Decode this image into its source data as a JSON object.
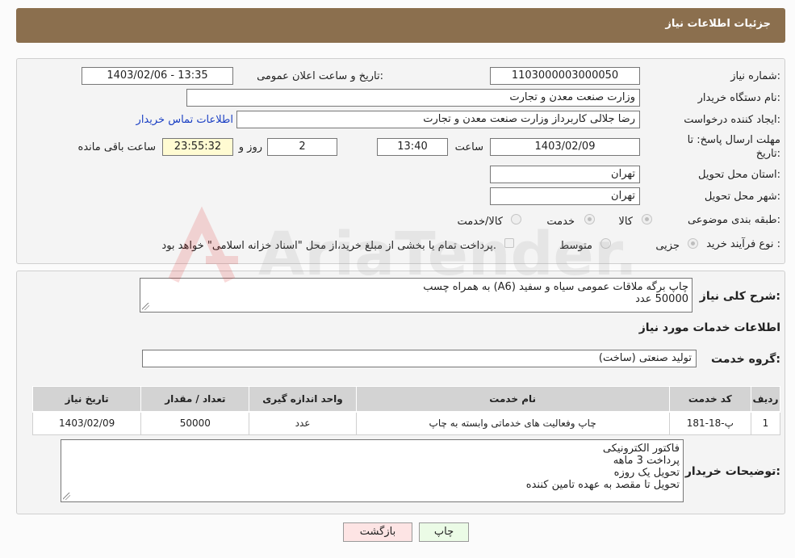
{
  "header": {
    "title": "جزئیات اطلاعات نیاز"
  },
  "form": {
    "need_number_label": "شماره نیاز:",
    "need_number": "1103000003000050",
    "announce_label": "تاریخ و ساعت اعلان عمومی:",
    "announce_value": "1403/02/06 - 13:35",
    "buyer_org_label": "نام دستگاه خریدار:",
    "buyer_org": "وزارت صنعت معدن و تجارت",
    "creator_label": "ایجاد کننده درخواست:",
    "creator": "رضا جلالی کاربرداز وزارت صنعت معدن و تجارت",
    "contact_link": "اطلاعات تماس خریدار",
    "deadline_label_1": "مهلت ارسال پاسخ: تا",
    "deadline_label_2": "تاریخ:",
    "deadline_date": "1403/02/09",
    "time_label": "ساعت",
    "deadline_time": "13:40",
    "days": "2",
    "days_label": "روز و",
    "remaining": "23:55:32",
    "remaining_label": "ساعت باقی مانده",
    "province_label": "استان محل تحویل:",
    "province": "تهران",
    "city_label": "شهر محل تحویل:",
    "city": "تهران",
    "category_label": "طبقه بندی موضوعی:",
    "category_options": [
      "کالا",
      "خدمت",
      "کالا/خدمت"
    ],
    "process_label": "نوع فرآیند خرید :",
    "process_options": [
      "جزیی",
      "متوسط"
    ],
    "payment_note": "پرداخت تمام یا بخشی از مبلغ خرید،از محل \"اسناد خزانه اسلامی\" خواهد بود."
  },
  "detail": {
    "summary_label": "شرح کلی نیاز:",
    "summary_lines": [
      "چاپ برگه ملاقات عمومی سیاه و سفید (A6) به همراه چسب",
      "50000 عدد"
    ],
    "services_title": "اطلاعات خدمات مورد نیاز",
    "group_label": "گروه خدمت:",
    "group_value": "تولید صنعتی (ساخت)",
    "table": {
      "headers": [
        "ردیف",
        "کد خدمت",
        "نام خدمت",
        "واحد اندازه گیری",
        "تعداد / مقدار",
        "تاریخ نیاز"
      ],
      "rows": [
        [
          "1",
          "پ-18-181",
          "چاپ وفعالیت های خدماتی وابسته به چاپ",
          "عدد",
          "50000",
          "1403/02/09"
        ]
      ]
    },
    "buyer_notes_label": "توضیحات خریدار:",
    "buyer_notes_lines": [
      "فاکتور الکترونیکی",
      "پرداخت 3 ماهه",
      "تحویل یک روزه",
      "تحویل تا مقصد به عهده تامین کننده"
    ]
  },
  "buttons": {
    "print": "چاپ",
    "back": "بازگشت"
  },
  "watermark": {
    "text": "AriaTender.neT"
  },
  "colors": {
    "header_bg": "#8b6f4e",
    "link": "#1a3fc4",
    "print_bg": "#ebfbe6",
    "back_bg": "#fde4e4",
    "yellow_box": "#fffbd2"
  }
}
